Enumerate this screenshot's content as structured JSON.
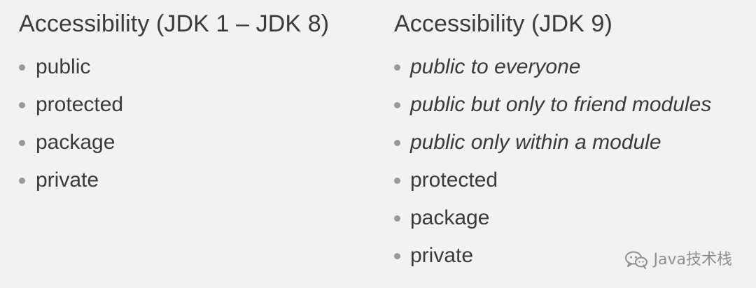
{
  "left": {
    "title": "Accessibility (JDK 1 – JDK 8)",
    "items": [
      {
        "text": "public",
        "italic": false
      },
      {
        "text": "protected",
        "italic": false
      },
      {
        "text": "package",
        "italic": false
      },
      {
        "text": "private",
        "italic": false
      }
    ]
  },
  "right": {
    "title": "Accessibility (JDK 9)",
    "items": [
      {
        "text": "public to everyone",
        "italic": true
      },
      {
        "text": "public but only to friend modules",
        "italic": true
      },
      {
        "text": "public only within a module",
        "italic": true
      },
      {
        "text": "protected",
        "italic": false
      },
      {
        "text": "package",
        "italic": false
      },
      {
        "text": "private",
        "italic": false
      }
    ]
  },
  "watermark": {
    "text": "Java技术栈",
    "icon": "wechat-icon"
  },
  "colors": {
    "background": "#f2f2f2",
    "text": "#3a3a3a",
    "bullet": "#9a9a9a",
    "watermark": "#8e8e8e"
  }
}
